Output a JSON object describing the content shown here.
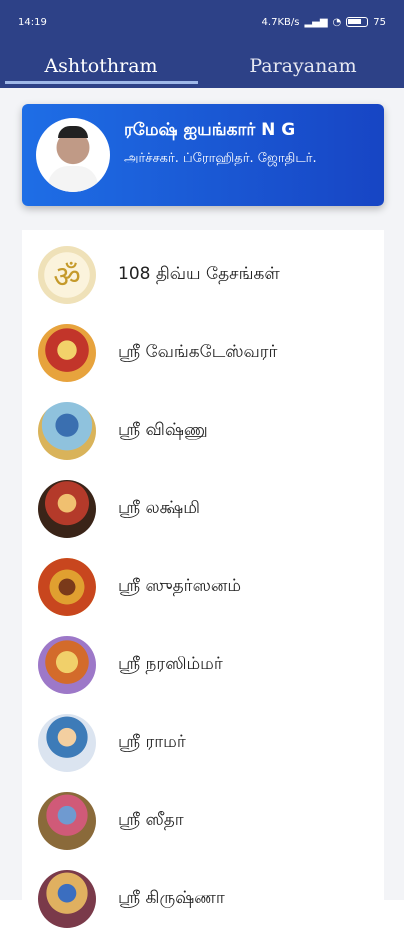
{
  "status_bar": {
    "time": "14:19",
    "net_speed": "4.7KB/s",
    "battery": "75"
  },
  "tabs": [
    {
      "label": "Ashtothram",
      "active": true
    },
    {
      "label": "Parayanam",
      "active": false
    }
  ],
  "profile": {
    "name": "ரமேஷ் ஐயங்கார் N G",
    "role": "அர்ச்சகர். ப்ரோஹிதர். ஜோதிடர்."
  },
  "items": [
    {
      "label": "108 திவ்ய தேசங்கள்",
      "icon": "om-icon"
    },
    {
      "label": "ஸ்ரீ வேங்கடேஸ்வரர்",
      "icon": "venkateswara-icon"
    },
    {
      "label": "ஸ்ரீ விஷ்ணு",
      "icon": "vishnu-icon"
    },
    {
      "label": "ஸ்ரீ லக்ஷ்மி",
      "icon": "lakshmi-icon"
    },
    {
      "label": "ஸ்ரீ ஸுதர்ஸனம்",
      "icon": "sudarshanam-icon"
    },
    {
      "label": "ஸ்ரீ நரஸிம்மர்",
      "icon": "narasimha-icon"
    },
    {
      "label": "ஸ்ரீ ராமர்",
      "icon": "rama-icon"
    },
    {
      "label": "ஸ்ரீ ஸீதா",
      "icon": "sita-icon"
    },
    {
      "label": "ஸ்ரீ கிருஷ்ணா",
      "icon": "krishna-icon"
    }
  ],
  "colors": {
    "header": "#2d4187",
    "card_gradient_start": "#1e6ee6",
    "card_gradient_end": "#1745c4"
  }
}
